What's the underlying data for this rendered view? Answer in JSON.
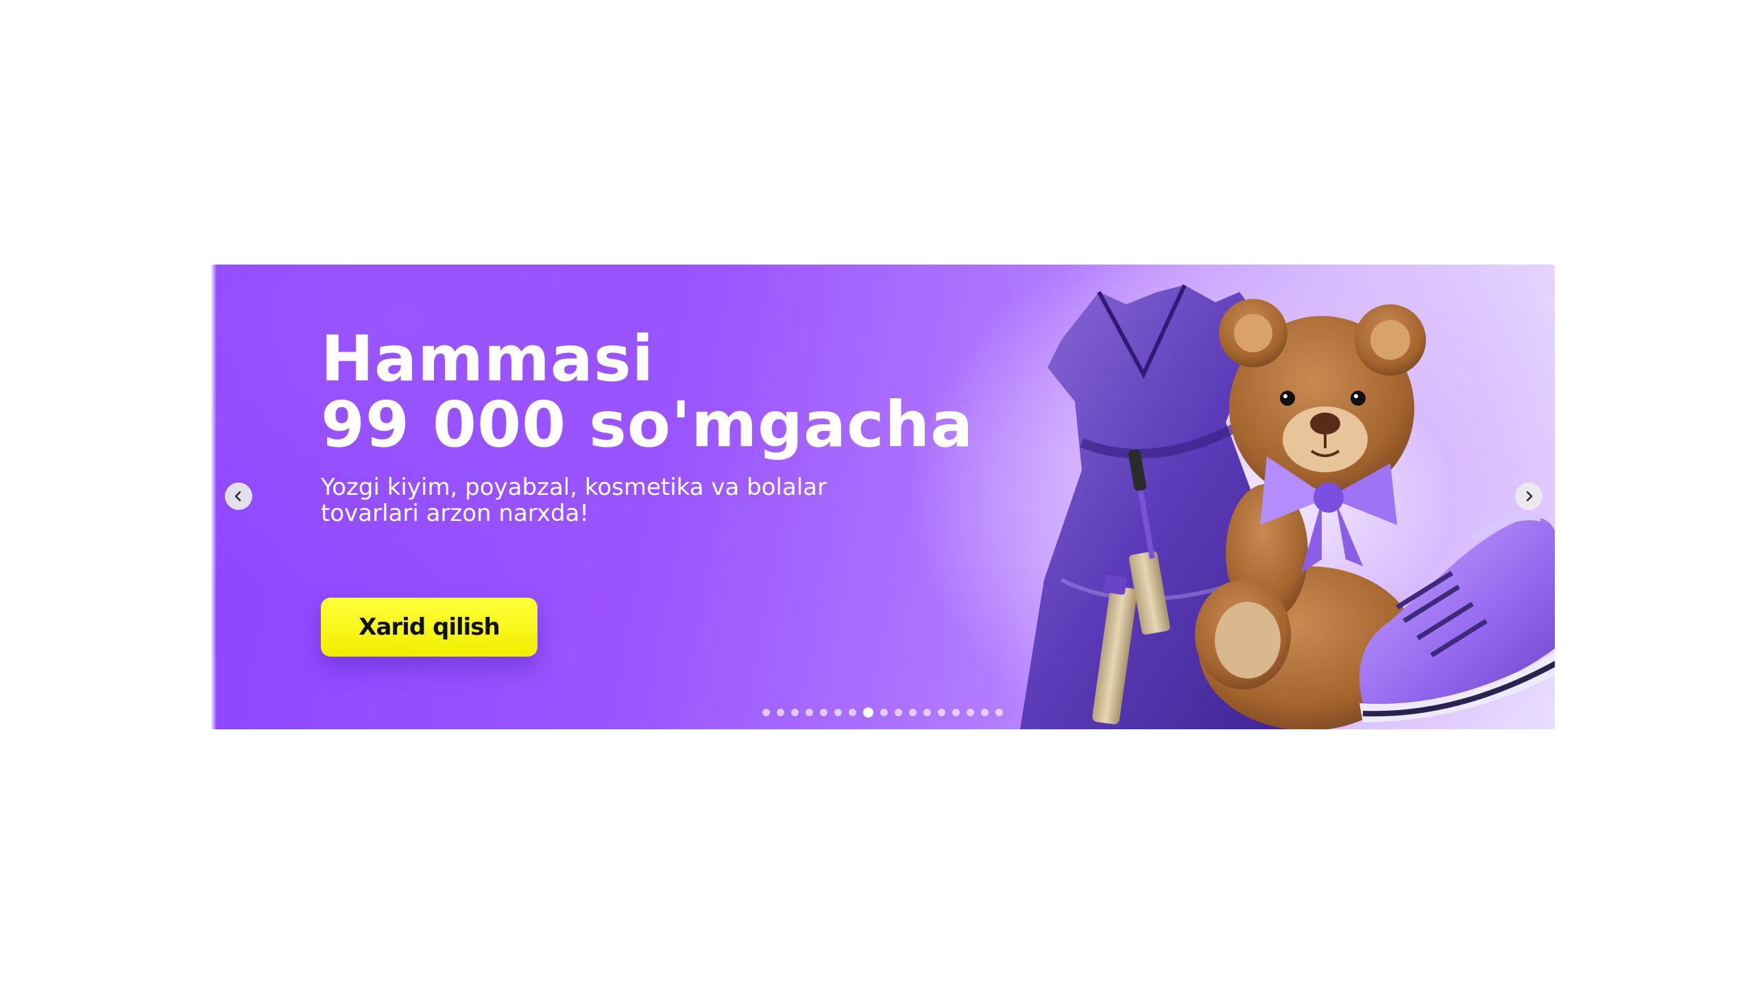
{
  "banner": {
    "title_line1": "Hammasi",
    "title_line2": "99 000 so'mgacha",
    "subtitle_line1": "Yozgi kiyim, poyabzal, kosmetika va bolalar",
    "subtitle_line2": "tovarlari arzon narxda!",
    "cta_label": "Xarid qilish",
    "prev_icon": "chevron-left-icon",
    "next_icon": "chevron-right-icon",
    "slide_count": 17,
    "active_slide": 8,
    "colors": {
      "background": "#9b55ff",
      "cta": "#f5f21a",
      "text": "#ffffff"
    },
    "illustration_items": [
      "dress-illustration",
      "teddy-bear-illustration",
      "sneaker-illustration",
      "mascara-illustration"
    ]
  }
}
